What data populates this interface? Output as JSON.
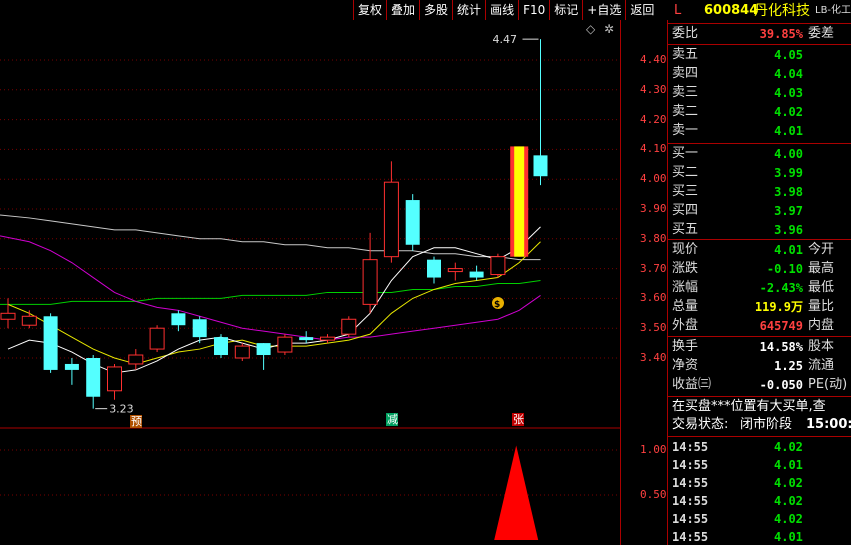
{
  "toolbar": [
    "复权",
    "叠加",
    "多股",
    "统计",
    "画线",
    "F10",
    "标记",
    "+自选",
    "返回"
  ],
  "chart_marks": {
    "high_label": "4.47",
    "low_label": "3.23",
    "tag_yu": "预",
    "tag_jian": "减",
    "tag_zhang": "张"
  },
  "y_axis_main": [
    "4.40",
    "4.30",
    "4.20",
    "4.10",
    "4.00",
    "3.90",
    "3.80",
    "3.70",
    "3.60",
    "3.50",
    "3.40"
  ],
  "y_axis_sub": [
    "1.00",
    "0.50"
  ],
  "header": {
    "flag": "L",
    "code": "600844",
    "name": "丹化科技",
    "suffix": "LB-化工"
  },
  "weibi": {
    "label": "委比",
    "value": "39.85%",
    "label2": "委差"
  },
  "asks": [
    {
      "label": "卖五",
      "price": "4.05"
    },
    {
      "label": "卖四",
      "price": "4.04"
    },
    {
      "label": "卖三",
      "price": "4.03"
    },
    {
      "label": "卖二",
      "price": "4.02"
    },
    {
      "label": "卖一",
      "price": "4.01"
    }
  ],
  "bids": [
    {
      "label": "买一",
      "price": "4.00"
    },
    {
      "label": "买二",
      "price": "3.99"
    },
    {
      "label": "买三",
      "price": "3.98"
    },
    {
      "label": "买四",
      "price": "3.97"
    },
    {
      "label": "买五",
      "price": "3.96"
    }
  ],
  "quote": [
    {
      "label": "现价",
      "value": "4.01",
      "label2": "今开"
    },
    {
      "label": "涨跌",
      "value": "-0.10",
      "label2": "最高"
    },
    {
      "label": "涨幅",
      "value": "-2.43%",
      "label2": "最低"
    },
    {
      "label": "总量",
      "value": "119.9万",
      "label2": "量比"
    },
    {
      "label": "外盘",
      "value": "645749",
      "label2": "内盘"
    }
  ],
  "fund": [
    {
      "label": "换手",
      "value": "14.58%",
      "label2": "股本"
    },
    {
      "label": "净资",
      "value": "1.25",
      "label2": "流通"
    },
    {
      "label": "收益㈢",
      "value": "-0.050",
      "label2": "PE(动)"
    }
  ],
  "notice1": "在买盘***位置有大买单,查",
  "notice2_label": "交易状态:",
  "notice2_value": "闭市阶段",
  "notice2_time": "15:00:",
  "ticks": [
    {
      "time": "14:55",
      "price": "4.02"
    },
    {
      "time": "14:55",
      "price": "4.01"
    },
    {
      "time": "14:55",
      "price": "4.02"
    },
    {
      "time": "14:55",
      "price": "4.02"
    },
    {
      "time": "14:55",
      "price": "4.02"
    },
    {
      "time": "14:55",
      "price": "4.01"
    }
  ],
  "candles": [
    {
      "o": 3.53,
      "c": 3.55,
      "h": 3.6,
      "l": 3.5
    },
    {
      "o": 3.51,
      "c": 3.54,
      "h": 3.56,
      "l": 3.5
    },
    {
      "o": 3.54,
      "c": 3.36,
      "h": 3.55,
      "l": 3.35
    },
    {
      "o": 3.38,
      "c": 3.36,
      "h": 3.4,
      "l": 3.31
    },
    {
      "o": 3.4,
      "c": 3.27,
      "h": 3.41,
      "l": 3.23
    },
    {
      "o": 3.29,
      "c": 3.37,
      "h": 3.38,
      "l": 3.26
    },
    {
      "o": 3.38,
      "c": 3.41,
      "h": 3.43,
      "l": 3.36
    },
    {
      "o": 3.43,
      "c": 3.5,
      "h": 3.51,
      "l": 3.42
    },
    {
      "o": 3.55,
      "c": 3.51,
      "h": 3.56,
      "l": 3.49
    },
    {
      "o": 3.53,
      "c": 3.47,
      "h": 3.54,
      "l": 3.45
    },
    {
      "o": 3.47,
      "c": 3.41,
      "h": 3.48,
      "l": 3.4
    },
    {
      "o": 3.4,
      "c": 3.44,
      "h": 3.45,
      "l": 3.39
    },
    {
      "o": 3.45,
      "c": 3.41,
      "h": 3.45,
      "l": 3.36
    },
    {
      "o": 3.42,
      "c": 3.47,
      "h": 3.48,
      "l": 3.41
    },
    {
      "o": 3.47,
      "c": 3.46,
      "h": 3.49,
      "l": 3.45
    },
    {
      "o": 3.46,
      "c": 3.47,
      "h": 3.48,
      "l": 3.45
    },
    {
      "o": 3.48,
      "c": 3.53,
      "h": 3.54,
      "l": 3.47
    },
    {
      "o": 3.58,
      "c": 3.73,
      "h": 3.82,
      "l": 3.55
    },
    {
      "o": 3.74,
      "c": 3.99,
      "h": 4.06,
      "l": 3.72
    },
    {
      "o": 3.93,
      "c": 3.78,
      "h": 3.95,
      "l": 3.76
    },
    {
      "o": 3.73,
      "c": 3.67,
      "h": 3.74,
      "l": 3.65
    },
    {
      "o": 3.69,
      "c": 3.7,
      "h": 3.72,
      "l": 3.66
    },
    {
      "o": 3.69,
      "c": 3.67,
      "h": 3.71,
      "l": 3.66
    },
    {
      "o": 3.68,
      "c": 3.74,
      "h": 3.75,
      "l": 3.67
    },
    {
      "o": 3.74,
      "c": 4.11,
      "h": 4.11,
      "l": 3.74
    },
    {
      "o": 4.08,
      "c": 4.01,
      "h": 4.47,
      "l": 3.98
    }
  ],
  "ma_white": [
    3.43,
    3.46,
    3.45,
    3.42,
    3.38,
    3.35,
    3.36,
    3.39,
    3.43,
    3.46,
    3.47,
    3.45,
    3.43,
    3.45,
    3.45,
    3.46,
    3.48,
    3.55,
    3.66,
    3.74,
    3.77,
    3.77,
    3.75,
    3.73,
    3.77,
    3.84
  ],
  "ma_yellow": [
    3.58,
    3.55,
    3.51,
    3.47,
    3.43,
    3.4,
    3.38,
    3.4,
    3.42,
    3.43,
    3.45,
    3.46,
    3.44,
    3.44,
    3.44,
    3.45,
    3.46,
    3.48,
    3.55,
    3.6,
    3.63,
    3.65,
    3.66,
    3.67,
    3.72,
    3.79
  ],
  "ma_magenta": [
    3.81,
    3.79,
    3.76,
    3.72,
    3.67,
    3.62,
    3.59,
    3.57,
    3.56,
    3.54,
    3.52,
    3.5,
    3.49,
    3.48,
    3.47,
    3.46,
    3.47,
    3.47,
    3.48,
    3.49,
    3.5,
    3.51,
    3.52,
    3.53,
    3.56,
    3.61
  ],
  "ma_green": [
    3.58,
    3.58,
    3.58,
    3.59,
    3.59,
    3.59,
    3.59,
    3.6,
    3.6,
    3.6,
    3.6,
    3.61,
    3.61,
    3.61,
    3.61,
    3.62,
    3.62,
    3.62,
    3.62,
    3.63,
    3.63,
    3.64,
    3.64,
    3.65,
    3.65,
    3.66
  ],
  "ma_gray": [
    3.88,
    3.87,
    3.86,
    3.85,
    3.84,
    3.83,
    3.83,
    3.82,
    3.81,
    3.8,
    3.8,
    3.79,
    3.79,
    3.78,
    3.78,
    3.77,
    3.77,
    3.76,
    3.76,
    3.76,
    3.75,
    3.75,
    3.74,
    3.74,
    3.73,
    3.73
  ],
  "colors": {
    "up": "#ff3030",
    "down": "#54ffff",
    "frame": "#aa0000",
    "yellow_bar": "#ffff00"
  },
  "volume_signal": 1.05
}
